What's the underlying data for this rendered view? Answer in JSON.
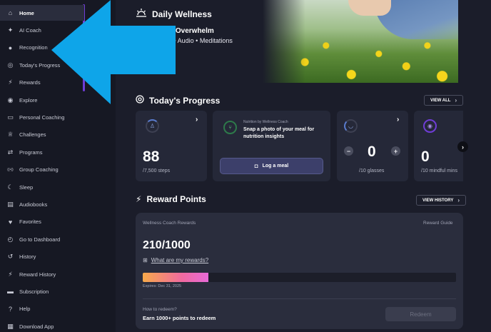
{
  "sidebar": {
    "items": [
      {
        "label": "Home",
        "icon": "home-icon",
        "glyph": "⌂"
      },
      {
        "label": "AI Coach",
        "icon": "sparkle-icon",
        "glyph": "✦"
      },
      {
        "label": "Recognition",
        "icon": "user-icon",
        "glyph": "●"
      },
      {
        "label": "Today's Progress",
        "icon": "target-icon",
        "glyph": "◎"
      },
      {
        "label": "Rewards",
        "icon": "bolt-icon",
        "glyph": "⚡"
      },
      {
        "label": "Explore",
        "icon": "compass-icon",
        "glyph": "◉"
      },
      {
        "label": "Personal Coaching",
        "icon": "chat-icon",
        "glyph": "▭"
      },
      {
        "label": "Challenges",
        "icon": "trophy-icon",
        "glyph": "♕"
      },
      {
        "label": "Programs",
        "icon": "swap-icon",
        "glyph": "⇄"
      },
      {
        "label": "Group Coaching",
        "icon": "broadcast-icon",
        "glyph": "((•))"
      },
      {
        "label": "Sleep",
        "icon": "moon-icon",
        "glyph": "☾"
      },
      {
        "label": "Audiobooks",
        "icon": "book-icon",
        "glyph": "▤"
      },
      {
        "label": "Favorites",
        "icon": "heart-icon",
        "glyph": "♥"
      },
      {
        "label": "Go to Dashboard",
        "icon": "dashboard-icon",
        "glyph": "◴"
      },
      {
        "label": "History",
        "icon": "history-icon",
        "glyph": "↺"
      },
      {
        "label": "Reward History",
        "icon": "bolt-icon",
        "glyph": "⚡"
      },
      {
        "label": "Subscription",
        "icon": "card-icon",
        "glyph": "▬"
      },
      {
        "label": "Help",
        "icon": "help-icon",
        "glyph": "?"
      },
      {
        "label": "Download App",
        "icon": "qr-icon",
        "glyph": "▦"
      }
    ]
  },
  "hero": {
    "title": "Daily Wellness",
    "subtitle": "ning Overwhelm",
    "meta": "mins • Audio • Meditations"
  },
  "progress": {
    "title": "Today's Progress",
    "view_all": "VIEW ALL",
    "steps": {
      "value": "88",
      "sub": "/7,500 steps"
    },
    "nutrition": {
      "kicker": "Nutrition by Wellness Coach",
      "text": "Snap a photo of your meal for nutrition insights",
      "button": "Log a meal"
    },
    "water": {
      "value": "0",
      "sub": "/10 glasses",
      "minus": "−",
      "plus": "+"
    },
    "mindful": {
      "value": "0",
      "sub": "/10 mindful mins"
    }
  },
  "rewards": {
    "title": "Reward Points",
    "view_history": "VIEW HISTORY",
    "card_title": "Wellness Coach Rewards",
    "guide": "Reward Guide",
    "points": "210/1000",
    "progress": 0.21,
    "what_link": "What are my rewards?",
    "expires": "Expires: Dec 31, 2025",
    "how": "How to redeem?",
    "earn": "Earn 1000+ points to redeem",
    "redeem": "Redeem"
  },
  "colors": {
    "accent": "#6f3dd6",
    "arrow": "#0ea5e9",
    "background": "#1b1d2a"
  }
}
